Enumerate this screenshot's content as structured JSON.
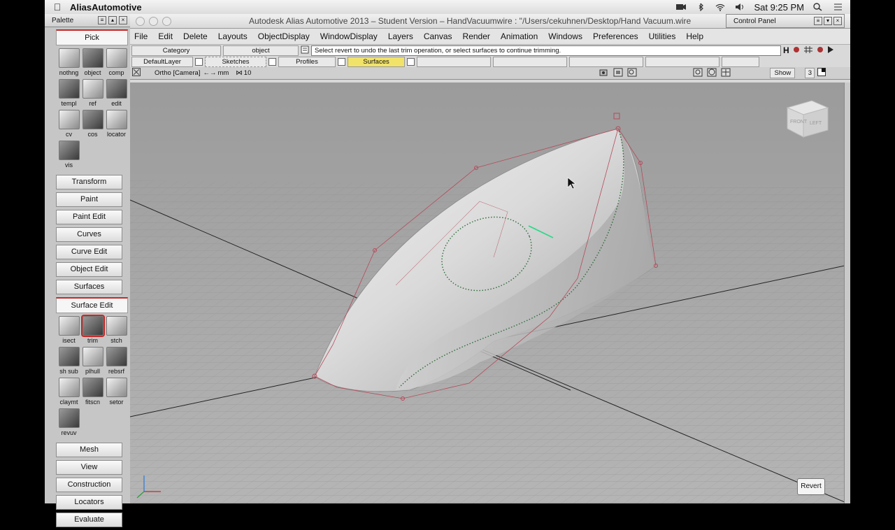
{
  "menubar": {
    "app_name": "AliasAutomotive",
    "clock": "Sat 9:25 PM"
  },
  "palette": {
    "title": "Palette",
    "pick_header": "Pick",
    "pick_tools": [
      {
        "label": "nothng",
        "icon": "pick-nothing-icon"
      },
      {
        "label": "object",
        "icon": "pick-object-icon"
      },
      {
        "label": "comp",
        "icon": "pick-component-icon"
      },
      {
        "label": "templ",
        "icon": "pick-template-icon"
      },
      {
        "label": "ref",
        "icon": "pick-reference-icon"
      },
      {
        "label": "edit",
        "icon": "pick-edit-icon"
      },
      {
        "label": "cv",
        "icon": "pick-cv-icon"
      },
      {
        "label": "cos",
        "icon": "pick-cos-icon"
      },
      {
        "label": "locator",
        "icon": "pick-locator-icon"
      },
      {
        "label": "vis",
        "icon": "pick-visible-icon"
      }
    ],
    "sections_top": [
      "Transform",
      "Paint",
      "Paint Edit",
      "Curves",
      "Curve Edit",
      "Object Edit",
      "Surfaces"
    ],
    "surface_edit_header": "Surface Edit",
    "surface_edit_tools": [
      {
        "label": "isect",
        "icon": "intersect-icon"
      },
      {
        "label": "trim",
        "icon": "trim-icon",
        "selected": true
      },
      {
        "label": "stch",
        "icon": "stitch-icon"
      },
      {
        "label": "sh sub",
        "icon": "shell-subdivide-icon"
      },
      {
        "label": "plhull",
        "icon": "polyhull-icon"
      },
      {
        "label": "rebsrf",
        "icon": "rebuild-surface-icon"
      },
      {
        "label": "claymt",
        "icon": "clay-mount-icon"
      },
      {
        "label": "fitscn",
        "icon": "fit-scan-icon"
      },
      {
        "label": "setor",
        "icon": "set-orientation-icon"
      },
      {
        "label": "revuv",
        "icon": "reverse-uv-icon"
      }
    ],
    "sections_bottom": [
      "Mesh",
      "View",
      "Construction",
      "Locators",
      "Evaluate"
    ]
  },
  "window": {
    "title": "Autodesk Alias Automotive 2013 – Student Version – HandVacuumwire : \"/Users/cekuhnen/Desktop/Hand Vacuum.wire",
    "menus": [
      "File",
      "Edit",
      "Delete",
      "Layouts",
      "ObjectDisplay",
      "WindowDisplay",
      "Layers",
      "Canvas",
      "Render",
      "Animation",
      "Windows",
      "Preferences",
      "Utilities",
      "Help"
    ]
  },
  "control_panel": {
    "title": "Control Panel"
  },
  "toolbar": {
    "category": "Category",
    "object": "object",
    "prompt": "Select revert to undo the last trim operation, or select surfaces to continue trimming."
  },
  "layers": {
    "default": "DefaultLayer",
    "sketches": "Sketches",
    "profiles": "Profiles",
    "surfaces": "Surfaces"
  },
  "viewport": {
    "view_label": "Ortho [Camera]",
    "unit": "mm",
    "grid_value": "10",
    "show_label": "Show",
    "layout_number": "3",
    "cube_face_front": "FRONT",
    "cube_face_left": "LEFT",
    "revert_label": "Revert"
  },
  "colors": {
    "trim_curve": "#2e6b3a",
    "cv_hull": "#b54a5a",
    "surfaces_layer": "#f1e36a",
    "selection_outline": "#c62828"
  }
}
